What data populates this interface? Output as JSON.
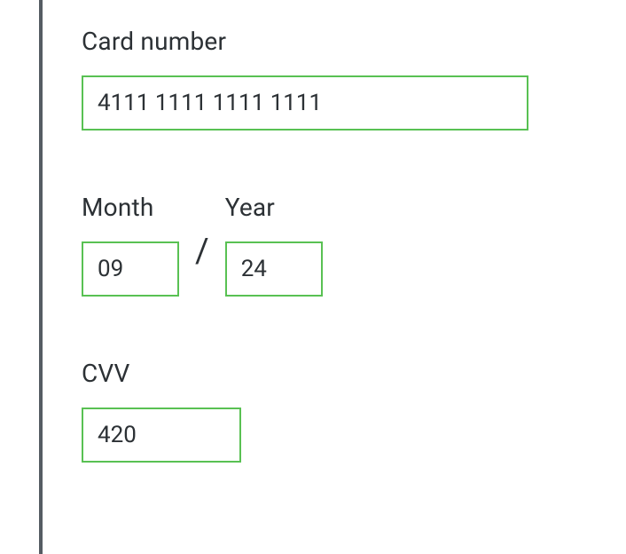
{
  "card": {
    "number_label": "Card number",
    "number_value": "4111 1111 1111 1111",
    "month_label": "Month",
    "month_value": "09",
    "year_label": "Year",
    "year_value": "24",
    "separator": "/",
    "cvv_label": "CVV",
    "cvv_value": "420"
  },
  "colors": {
    "input_border": "#59c153",
    "text": "#2c3135"
  }
}
